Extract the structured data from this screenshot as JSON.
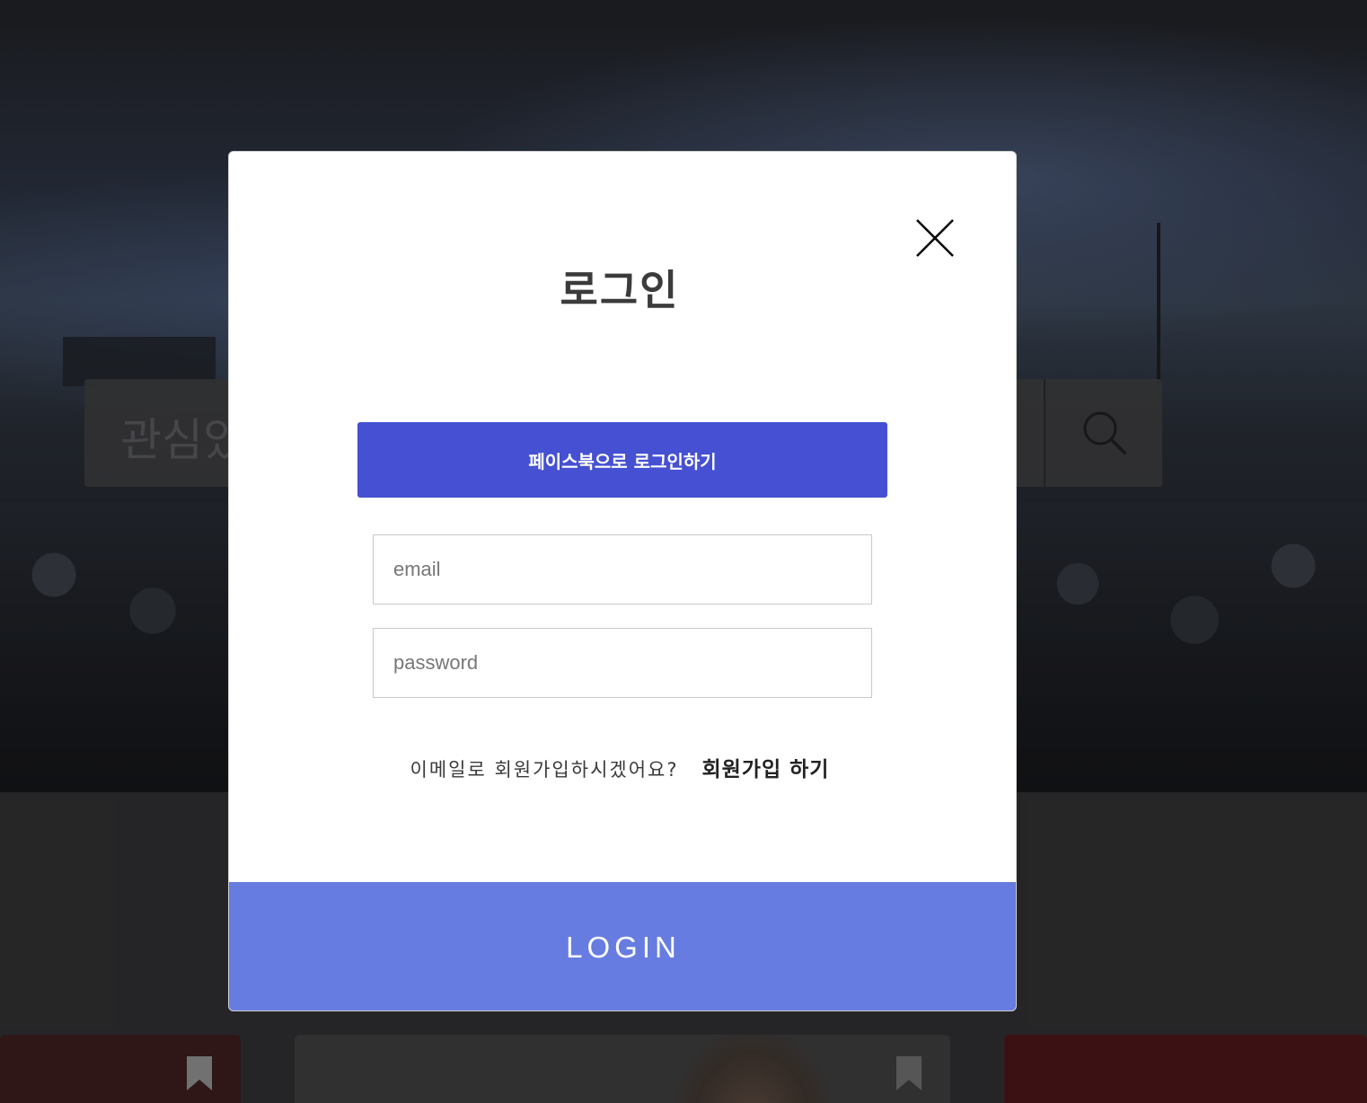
{
  "background": {
    "search": {
      "placeholder_visible": "관심있"
    },
    "icons": {
      "search": "search-icon",
      "bookmark": "bookmark-icon"
    }
  },
  "modal": {
    "title": "로그인",
    "close_icon": "close-icon",
    "facebook_button": "페이스북으로 로그인하기",
    "email_placeholder": "email",
    "password_placeholder": "password",
    "signup_prompt": "이메일로 회원가입하시겠어요?",
    "signup_link": "회원가입 하기",
    "login_button": "LOGIN"
  },
  "colors": {
    "facebook_button": "#4550d2",
    "login_button": "#677ce0",
    "title": "#3b3b3b"
  }
}
